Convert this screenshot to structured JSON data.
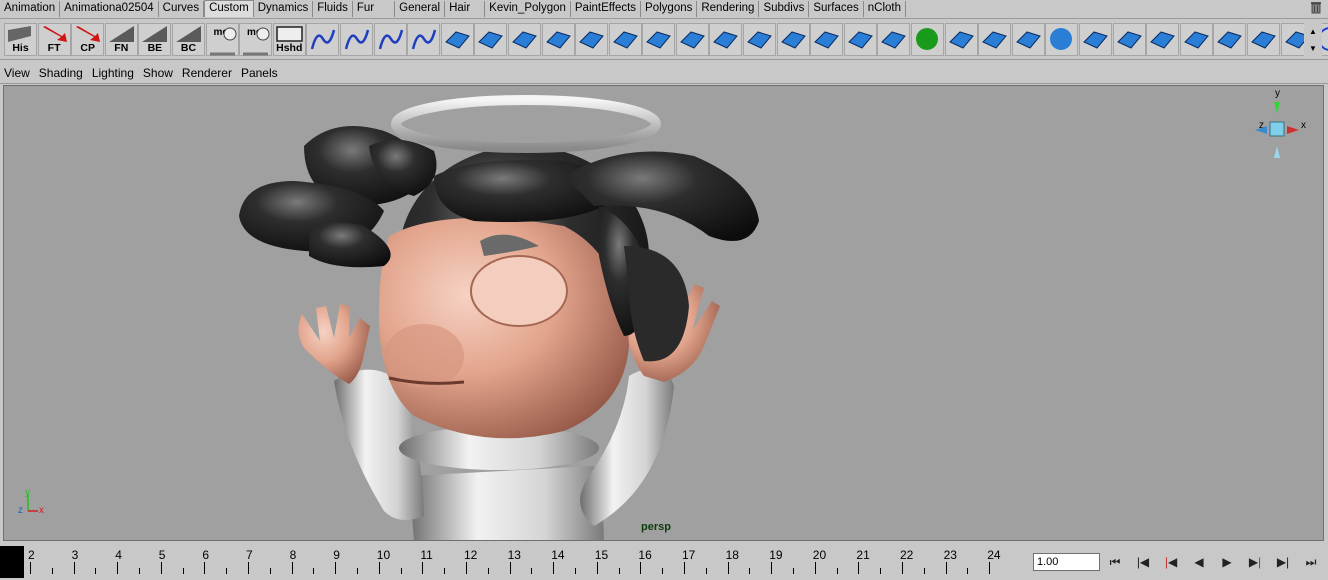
{
  "shelf_tabs": [
    "Animation",
    "Animationa02504",
    "Curves",
    "Custom",
    "Dynamics",
    "Fluids",
    "Fur",
    "General",
    "Hair",
    "Kevin_Polygon",
    "PaintEffects",
    "Polygons",
    "Rendering",
    "Subdivs",
    "Surfaces",
    "nCloth"
  ],
  "active_tab": "Custom",
  "shelf_buttons": [
    {
      "label": "His",
      "icon": "history-icon"
    },
    {
      "label": "FT",
      "icon": "freeze-transform-icon"
    },
    {
      "label": "CP",
      "icon": "center-pivot-icon"
    },
    {
      "label": "FN",
      "icon": "fn-script-icon"
    },
    {
      "label": "BE",
      "icon": "be-script-icon"
    },
    {
      "label": "BC",
      "icon": "bc-script-icon"
    },
    {
      "label": "mel",
      "icon": "mel-script-icon"
    },
    {
      "label": "mel",
      "icon": "mel-script-icon"
    },
    {
      "label": "Hshd",
      "icon": "hypershade-icon"
    }
  ],
  "panel_menu": [
    "View",
    "Shading",
    "Lighting",
    "Show",
    "Renderer",
    "Panels"
  ],
  "viewport": {
    "camera": "persp",
    "view_cube_axes": {
      "y": "y",
      "x": "x",
      "z": "z"
    },
    "axis_indicator": {
      "y": "y",
      "x": "x",
      "z": "z"
    }
  },
  "timeline": {
    "frames": [
      "2",
      "3",
      "4",
      "5",
      "6",
      "7",
      "8",
      "9",
      "10",
      "11",
      "12",
      "13",
      "14",
      "15",
      "16",
      "17",
      "18",
      "19",
      "20",
      "21",
      "22",
      "23",
      "24"
    ],
    "current_frame": "1.00"
  },
  "playback": {
    "buttons": [
      "go-to-start-icon",
      "step-back-key-icon",
      "step-back-frame-icon",
      "play-backward-icon",
      "play-forward-icon",
      "step-forward-frame-icon",
      "step-forward-key-icon",
      "go-to-end-icon"
    ]
  },
  "colors": {
    "background": "#c8c8c8",
    "viewport": "#a0a0a0",
    "skin": "#e2a48c",
    "hair": "#262626",
    "cloth": "#d8d8d8",
    "tool_blue": "#2a7ed6"
  }
}
